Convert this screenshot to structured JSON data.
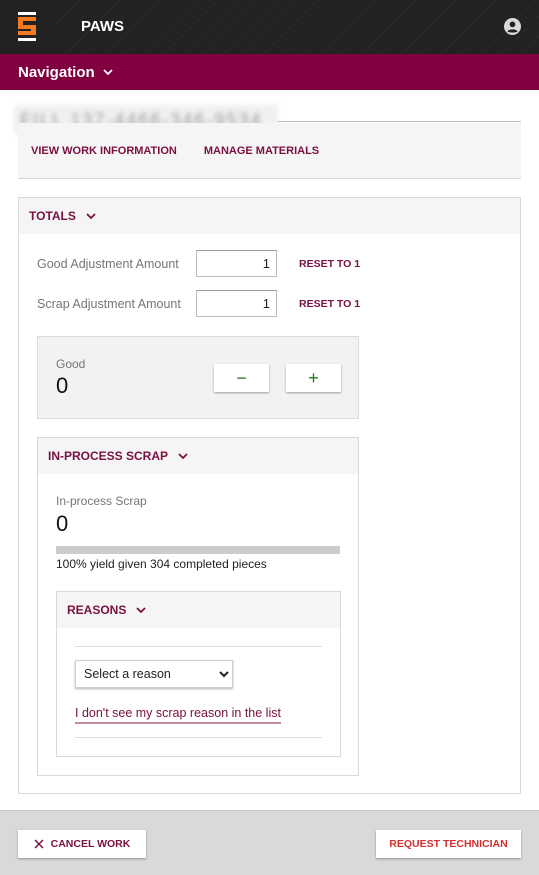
{
  "app": {
    "title": "PAWS",
    "logo_icon": "s-logo",
    "user_icon": "account-circle-icon"
  },
  "navigation": {
    "label": "Navigation",
    "icon": "chevron-down-icon"
  },
  "page": {
    "title_redacted": "FILL 137-4466-346-9534"
  },
  "tabs": [
    {
      "label": "VIEW WORK INFORMATION"
    },
    {
      "label": "MANAGE MATERIALS"
    }
  ],
  "totals": {
    "header": "TOTALS",
    "good_adjustment": {
      "label": "Good Adjustment Amount",
      "value": "1",
      "reset_label": "RESET TO 1"
    },
    "scrap_adjustment": {
      "label": "Scrap Adjustment Amount",
      "value": "1",
      "reset_label": "RESET TO 1"
    },
    "good": {
      "label": "Good",
      "value": "0",
      "decrement_label": "−",
      "increment_label": "+"
    },
    "in_process_scrap": {
      "header": "IN-PROCESS SCRAP",
      "label": "In-process Scrap",
      "value": "0",
      "yield_percent": 100,
      "yield_text": "100% yield given 304 completed pieces",
      "reasons": {
        "header": "REASONS",
        "select_value": "Select a reason",
        "missing_link": "I don't see my scrap reason in the list"
      }
    }
  },
  "footer": {
    "cancel_label": "CANCEL WORK",
    "cancel_icon": "close-icon",
    "technician_label": "REQUEST TECHNICIAN"
  },
  "colors": {
    "brand": "#800040",
    "accent_text": "#7a1040",
    "topbar": "#222222",
    "logo_orange": "#f47b20",
    "stepper_green": "#1f7a1f",
    "technician_red": "#d32f2f"
  }
}
